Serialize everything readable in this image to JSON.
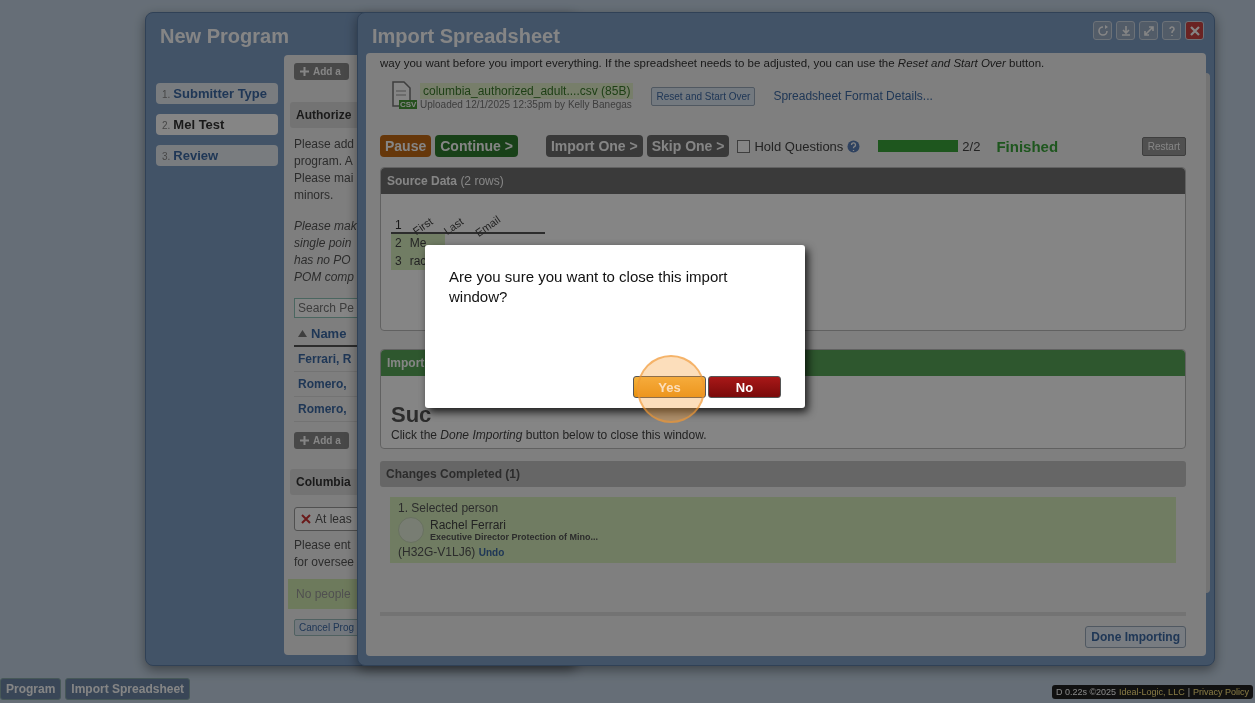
{
  "background_window": {
    "title": "New Program",
    "steps": [
      {
        "number": "1.",
        "label": "Submitter Type",
        "selected": false
      },
      {
        "number": "2.",
        "label": "Mel Test",
        "selected": true
      },
      {
        "number": "3.",
        "label": "Review",
        "selected": false
      }
    ],
    "content": {
      "add_button": "Add a",
      "section_title": "Authorize",
      "paragraph": [
        "Please add",
        "program. A",
        "Please mai",
        "minors."
      ],
      "italic_paragraph": [
        "Please mak",
        "single poin",
        "has no PO",
        "POM comp"
      ],
      "search": {
        "placeholder": "Search Pe"
      },
      "sort_header": "Name",
      "rows": [
        "Ferrari, R",
        "Romero,",
        "Romero,"
      ],
      "add_button_2": "Add a",
      "section_title_2": "Columbia",
      "error": "At leas",
      "note": [
        "Please ent",
        "for oversee"
      ],
      "empty": "No people",
      "cancel_button": "Cancel Prog"
    }
  },
  "import_window": {
    "title": "Import Spreadsheet",
    "intro": "way you want before you import everything. If the spreadsheet needs to be adjusted, you can use the *Reset and Start Over* button.",
    "file": {
      "badge": "CSV",
      "name": "columbia_authorized_adult....csv (85B)",
      "uploaded": "Uploaded 12/1/2025 12:35pm by Kelly Banegas"
    },
    "reset_button": "Reset and Start Over",
    "format_link": "Spreadsheet Format Details...",
    "controls": [
      {
        "label": "Pause",
        "kind": "pause",
        "disabled": true
      },
      {
        "label": "Continue >",
        "kind": "continue",
        "disabled": true
      },
      {
        "label": "Import One >",
        "kind": "step",
        "disabled": true
      },
      {
        "label": "Skip One >",
        "kind": "step",
        "disabled": true
      }
    ],
    "hold_questions": {
      "label": "Hold Questions",
      "checked": false
    },
    "progress": {
      "level": 1,
      "count": "2/2",
      "status": "Finished"
    },
    "restart_button": "Restart",
    "source": {
      "title": "Source Data",
      "count": "(2 rows)",
      "header_number": "1",
      "columns": [
        "First",
        "Last",
        "Email"
      ],
      "rows": [
        {
          "number": "2",
          "cell": "Me"
        },
        {
          "number": "3",
          "cell": "rac"
        }
      ]
    },
    "results": {
      "title": "Import",
      "heading": "Suc",
      "message": "Click the *Done Importing* button below to close this window."
    },
    "changes": {
      "title": "Changes Completed (1)",
      "items": [
        {
          "action": "1. Selected person",
          "name": "Rachel Ferrari",
          "role": "Executive Director Protection of Mino...",
          "code": "(H32G-V1LJ6)",
          "undo": "Undo"
        }
      ]
    },
    "done_button": "Done Importing"
  },
  "dialog": {
    "message": "Are you sure you want to close this import window?",
    "buttons": [
      {
        "label": "Yes",
        "kind": "confirm",
        "clicked": true
      },
      {
        "label": "No",
        "kind": "cancel",
        "clicked": false
      }
    ]
  },
  "taskbar": [
    {
      "label": "Program"
    },
    {
      "label": "Import Spreadsheet"
    }
  ],
  "footer": {
    "timing": "D  0.22s  ©2025",
    "company": "Ideal-Logic, LLC",
    "separator": "|",
    "privacy": "Privacy Policy"
  }
}
